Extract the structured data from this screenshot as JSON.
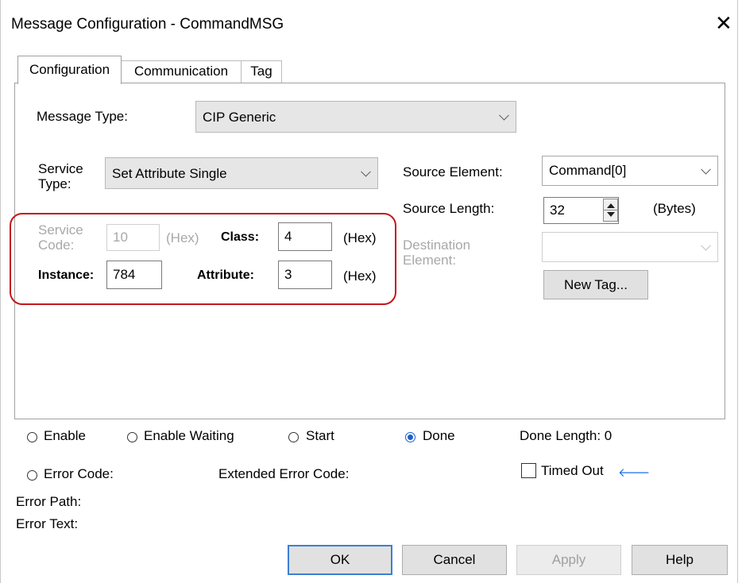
{
  "window": {
    "title": "Message Configuration - CommandMSG",
    "close_glyph": "✕"
  },
  "tabs": [
    {
      "label": "Configuration",
      "active": true
    },
    {
      "label": "Communication",
      "active": false
    },
    {
      "label": "Tag",
      "active": false
    }
  ],
  "config": {
    "message_type_label": "Message Type:",
    "message_type_value": "CIP Generic",
    "service_type_label_1": "Service",
    "service_type_label_2": "Type:",
    "service_type_value": "Set Attribute Single",
    "service_code_label_1": "Service",
    "service_code_label_2": "Code:",
    "service_code_value": "10",
    "service_code_unit": "(Hex)",
    "class_label": "Class:",
    "class_value": "4",
    "class_unit": "(Hex)",
    "instance_label": "Instance:",
    "instance_value": "784",
    "attribute_label": "Attribute:",
    "attribute_value": "3",
    "attribute_unit": "(Hex)",
    "source_element_label": "Source Element:",
    "source_element_value": "Command[0]",
    "source_length_label": "Source Length:",
    "source_length_value": "32",
    "source_length_unit": "(Bytes)",
    "destination_label_1": "Destination",
    "destination_label_2": "Element:",
    "destination_value": "",
    "new_tag_button": "New Tag..."
  },
  "status": {
    "enable": "Enable",
    "enable_waiting": "Enable Waiting",
    "start": "Start",
    "done": "Done",
    "done_selected": true,
    "done_length": "Done Length: 0",
    "error_code": "Error Code:",
    "extended_error_code": "Extended Error Code:",
    "timed_out": "Timed Out",
    "timed_out_arrow": "🡐",
    "error_path": "Error Path:",
    "error_text": "Error Text:"
  },
  "buttons": {
    "ok": "OK",
    "cancel": "Cancel",
    "apply": "Apply",
    "help": "Help"
  },
  "colors": {
    "highlight_border": "#c4161c",
    "radio_selected": "#1d5fd0",
    "default_button_border": "#3c7fd6"
  }
}
